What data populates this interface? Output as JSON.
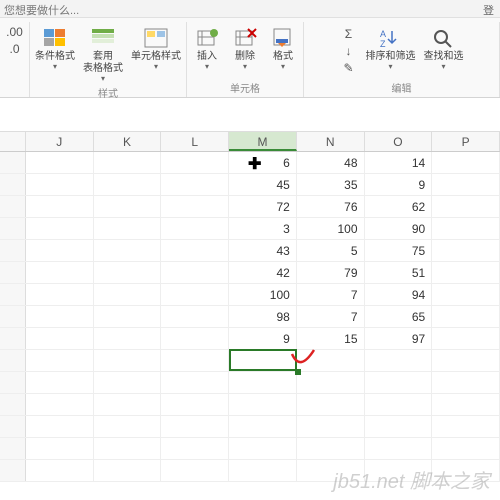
{
  "topbar": {
    "hint": "您想要做什么...",
    "login": "登"
  },
  "ribbon": {
    "leftsmall": {
      "decimal": ".00"
    },
    "styles": {
      "conditional": "条件格式",
      "table": "套用\n表格格式",
      "cell": "单元格样式",
      "group": "样式"
    },
    "cells": {
      "insert": "插入",
      "delete": "删除",
      "format": "格式",
      "group": "单元格"
    },
    "editing": {
      "sum": "Σ",
      "fill": "↓",
      "clear": "◆",
      "sort": "排序和筛选",
      "find": "查找和选",
      "group": "编辑"
    }
  },
  "columns": [
    "J",
    "K",
    "L",
    "M",
    "N",
    "O",
    "P"
  ],
  "selected_col_index": 3,
  "grid": [
    [
      "",
      "",
      "",
      "6",
      "48",
      "14",
      ""
    ],
    [
      "",
      "",
      "",
      "45",
      "35",
      "9",
      ""
    ],
    [
      "",
      "",
      "",
      "72",
      "76",
      "62",
      ""
    ],
    [
      "",
      "",
      "",
      "3",
      "100",
      "90",
      ""
    ],
    [
      "",
      "",
      "",
      "43",
      "5",
      "75",
      ""
    ],
    [
      "",
      "",
      "",
      "42",
      "79",
      "51",
      ""
    ],
    [
      "",
      "",
      "",
      "100",
      "7",
      "94",
      ""
    ],
    [
      "",
      "",
      "",
      "98",
      "7",
      "65",
      ""
    ],
    [
      "",
      "",
      "",
      "9",
      "15",
      "97",
      ""
    ],
    [
      "",
      "",
      "",
      "",
      "",
      "",
      ""
    ],
    [
      "",
      "",
      "",
      "",
      "",
      "",
      ""
    ],
    [
      "",
      "",
      "",
      "",
      "",
      "",
      ""
    ],
    [
      "",
      "",
      "",
      "",
      "",
      "",
      ""
    ],
    [
      "",
      "",
      "",
      "",
      "",
      "",
      ""
    ],
    [
      "",
      "",
      "",
      "",
      "",
      "",
      ""
    ]
  ],
  "selection": {
    "row": 9,
    "col": 3
  },
  "watermark": "jb51.net  脚本之家"
}
